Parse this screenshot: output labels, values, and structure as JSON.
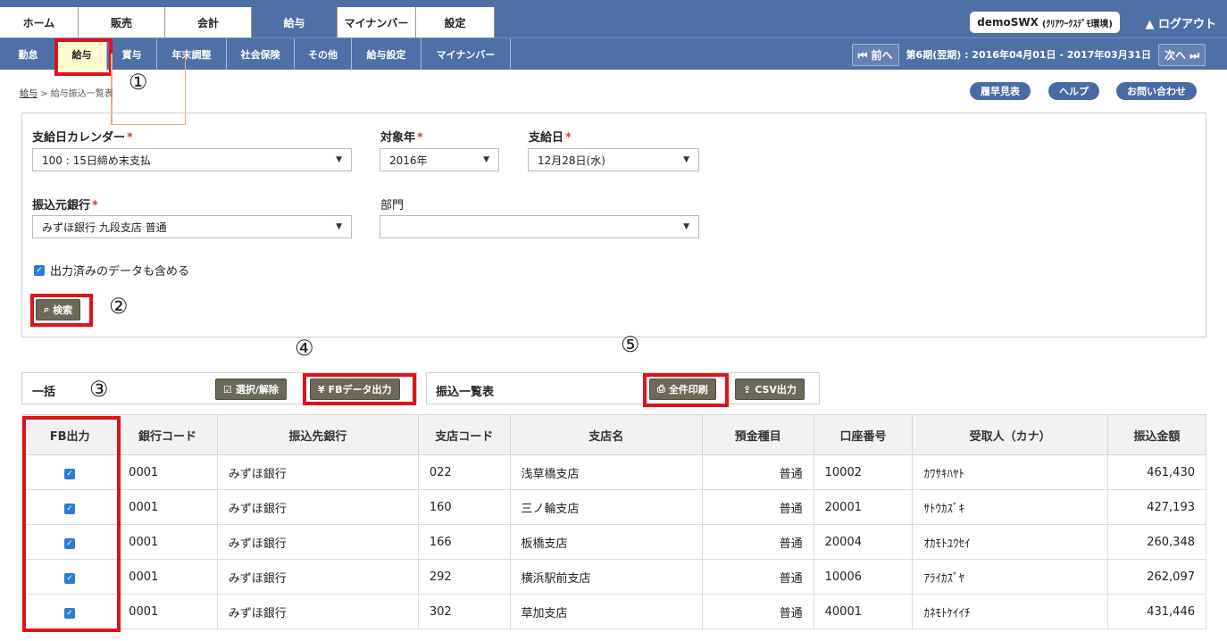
{
  "top_tabs": [
    "ホーム",
    "販売",
    "会計",
    "給与",
    "マイナンバー",
    "設定"
  ],
  "user": {
    "name": "demoSWX",
    "env": "(ｸﾘｱﾜｰｸｽﾃﾞﾓ環境)"
  },
  "logout": "▲ ログアウト",
  "sub_tabs": [
    "勤怠",
    "給与",
    "賞与",
    "年末調整",
    "社会保険",
    "その他",
    "給与設定",
    "マイナンバー"
  ],
  "period": {
    "prev": "⏮ 前へ",
    "text": "第6期(翌期) : 2016年04月01日 - 2017年03月31日",
    "next": "次へ ⏭"
  },
  "breadcrumb": {
    "link": "給与",
    "sep": ">",
    "current": "給与振込一覧表"
  },
  "help_buttons": [
    "履早見表",
    "ヘルプ",
    "お問い合わせ"
  ],
  "form": {
    "calendar_label": "支給日カレンダー",
    "calendar_value": "100 : 15日締め末支払",
    "year_label": "対象年",
    "year_value": "2016年",
    "payday_label": "支給日",
    "payday_value": "12月28日(水)",
    "bank_label": "振込元銀行",
    "bank_value": "みずほ銀行 九段支店 普通",
    "dept_label": "部門",
    "dept_value": "",
    "include_label": "出力済みのデータも含める",
    "search": "検索",
    "required": "*"
  },
  "markers": [
    "①",
    "②",
    "③",
    "④",
    "⑤"
  ],
  "bulk": {
    "label": "一括",
    "toggle": "選択/解除",
    "fb": "FBデータ出力"
  },
  "list": {
    "label": "振込一覧表",
    "print": "全件印刷",
    "csv": "CSV出力"
  },
  "table": {
    "headers": [
      "FB出力",
      "銀行コード",
      "振込先銀行",
      "支店コード",
      "支店名",
      "預金種目",
      "口座番号",
      "受取人（カナ）",
      "振込金額"
    ],
    "rows": [
      [
        "0001",
        "みずほ銀行",
        "022",
        "浅草橋支店",
        "普通",
        "10002",
        "ｶﾜｻｷﾊﾔﾄ",
        "461,430"
      ],
      [
        "0001",
        "みずほ銀行",
        "160",
        "三ノ輪支店",
        "普通",
        "20001",
        "ｻﾄｳｶｽﾞｷ",
        "427,193"
      ],
      [
        "0001",
        "みずほ銀行",
        "166",
        "板橋支店",
        "普通",
        "20004",
        "ｵｶﾓﾄﾕｳｾｲ",
        "260,348"
      ],
      [
        "0001",
        "みずほ銀行",
        "292",
        "横浜駅前支店",
        "普通",
        "10006",
        "ｱﾗｲｶｽﾞﾔ",
        "262,097"
      ],
      [
        "0001",
        "みずほ銀行",
        "302",
        "草加支店",
        "普通",
        "40001",
        "ｶﾈﾓﾄｹｲｲﾁ",
        "431,446"
      ]
    ]
  },
  "colors": {
    "nav": "#4f6fa7",
    "highlight": "#e0131a",
    "button": "#6b6a58",
    "check": "#2d7bd4"
  }
}
